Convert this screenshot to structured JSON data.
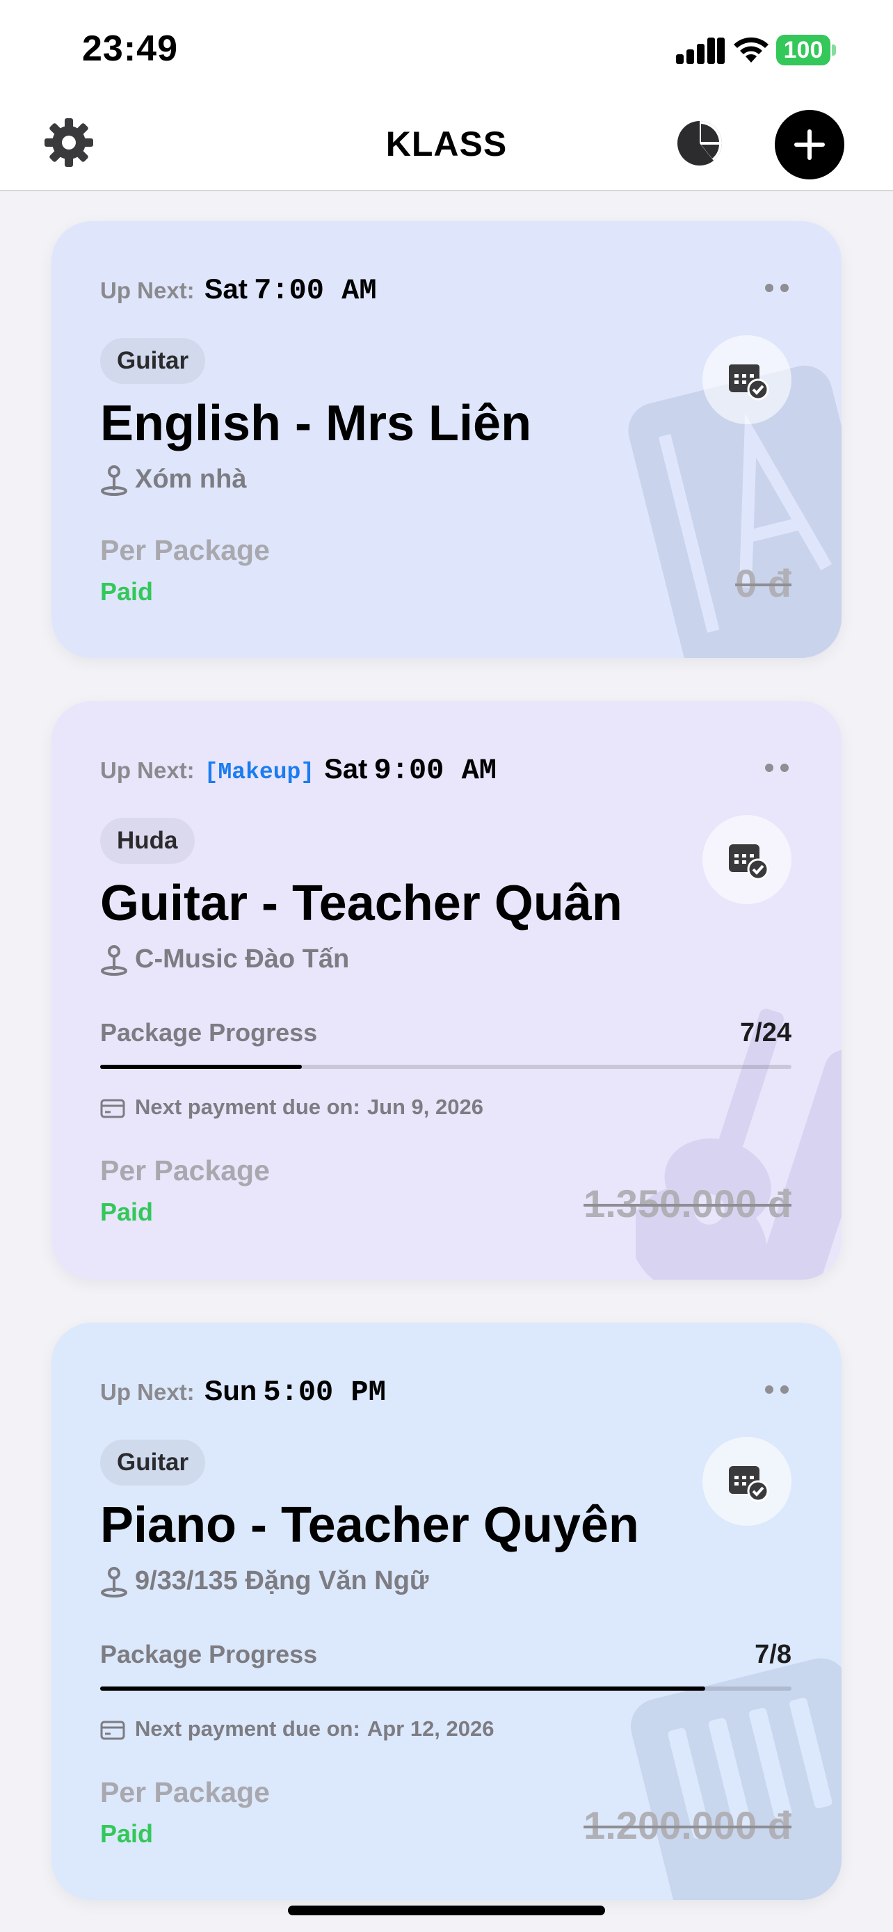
{
  "status_bar": {
    "time": "23:49",
    "battery": "100"
  },
  "nav": {
    "title": "KLASS"
  },
  "colors": {
    "accent": "#1a7cf0",
    "paid": "#34c759",
    "card1_bg": "#dfe6fb",
    "card2_bg": "#e9e6fb",
    "card3_bg": "#dce8fb"
  },
  "icons": [
    "gear-icon",
    "pie-chart-icon",
    "plus-icon",
    "more-dots-icon",
    "calendar-check-icon",
    "location-pin-icon",
    "credit-card-icon"
  ],
  "cards": [
    {
      "up_next_label": "Up Next:",
      "makeup": "",
      "day": "Sat",
      "time": "7:00 AM",
      "tag": "Guitar",
      "title": "English - Mrs Liên",
      "location": "Xóm nhà",
      "per_package": "Per Package",
      "status": "Paid",
      "price": "0 đ"
    },
    {
      "up_next_label": "Up Next:",
      "makeup": "[Makeup]",
      "day": "Sat",
      "time": "9:00 AM",
      "tag": "Huda",
      "title": "Guitar - Teacher Quân",
      "location": "C-Music Đào Tấn",
      "progress_label": "Package Progress",
      "progress_count": "7/24",
      "progress_fraction": 0.2917,
      "due_label": "Next payment due on:",
      "due_date": "Jun 9, 2026",
      "per_package": "Per Package",
      "status": "Paid",
      "price": "1.350.000 đ"
    },
    {
      "up_next_label": "Up Next:",
      "makeup": "",
      "day": "Sun",
      "time": "5:00 PM",
      "tag": "Guitar",
      "title": "Piano - Teacher Quyên",
      "location": "9/33/135 Đặng Văn Ngữ",
      "progress_label": "Package Progress",
      "progress_count": "7/8",
      "progress_fraction": 0.875,
      "due_label": "Next payment due on:",
      "due_date": "Apr 12, 2026",
      "per_package": "Per Package",
      "status": "Paid",
      "price": "1.200.000 đ"
    }
  ]
}
